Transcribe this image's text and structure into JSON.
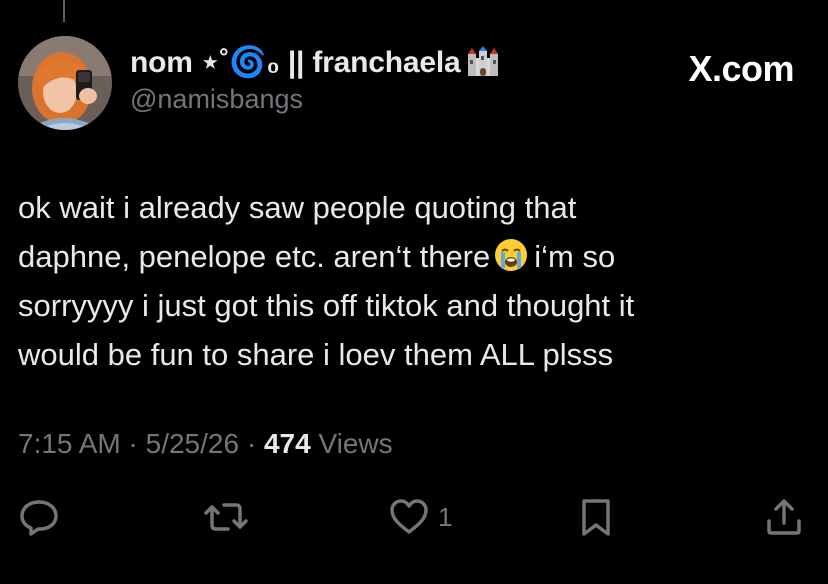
{
  "tweet": {
    "display_name": "nom ⋆˚🌀₀ || franchaela",
    "castle_emoji": "castle",
    "handle": "@namisbangs",
    "brand": "X.com",
    "text_lines": [
      "ok wait i already saw people quoting that",
      "daphne, penelope etc. aren‘t there",
      "i‘m so",
      "sorryyyy i just got this off tiktok and thought it",
      "would be fun to share i loev them ALL plsss"
    ],
    "emoji_inline": "loudly-crying-face",
    "time": "7:15 AM",
    "date": "5/25/26",
    "separator": "·",
    "views_count": "474",
    "views_label": "Views"
  },
  "actions": {
    "reply_icon": "reply-icon",
    "retweet_icon": "retweet-icon",
    "like_icon": "heart-icon",
    "like_count": "1",
    "bookmark_icon": "bookmark-icon",
    "share_icon": "share-icon"
  },
  "colors": {
    "background": "#000000",
    "text_primary": "#e7e9ea",
    "text_secondary": "#71767b"
  }
}
